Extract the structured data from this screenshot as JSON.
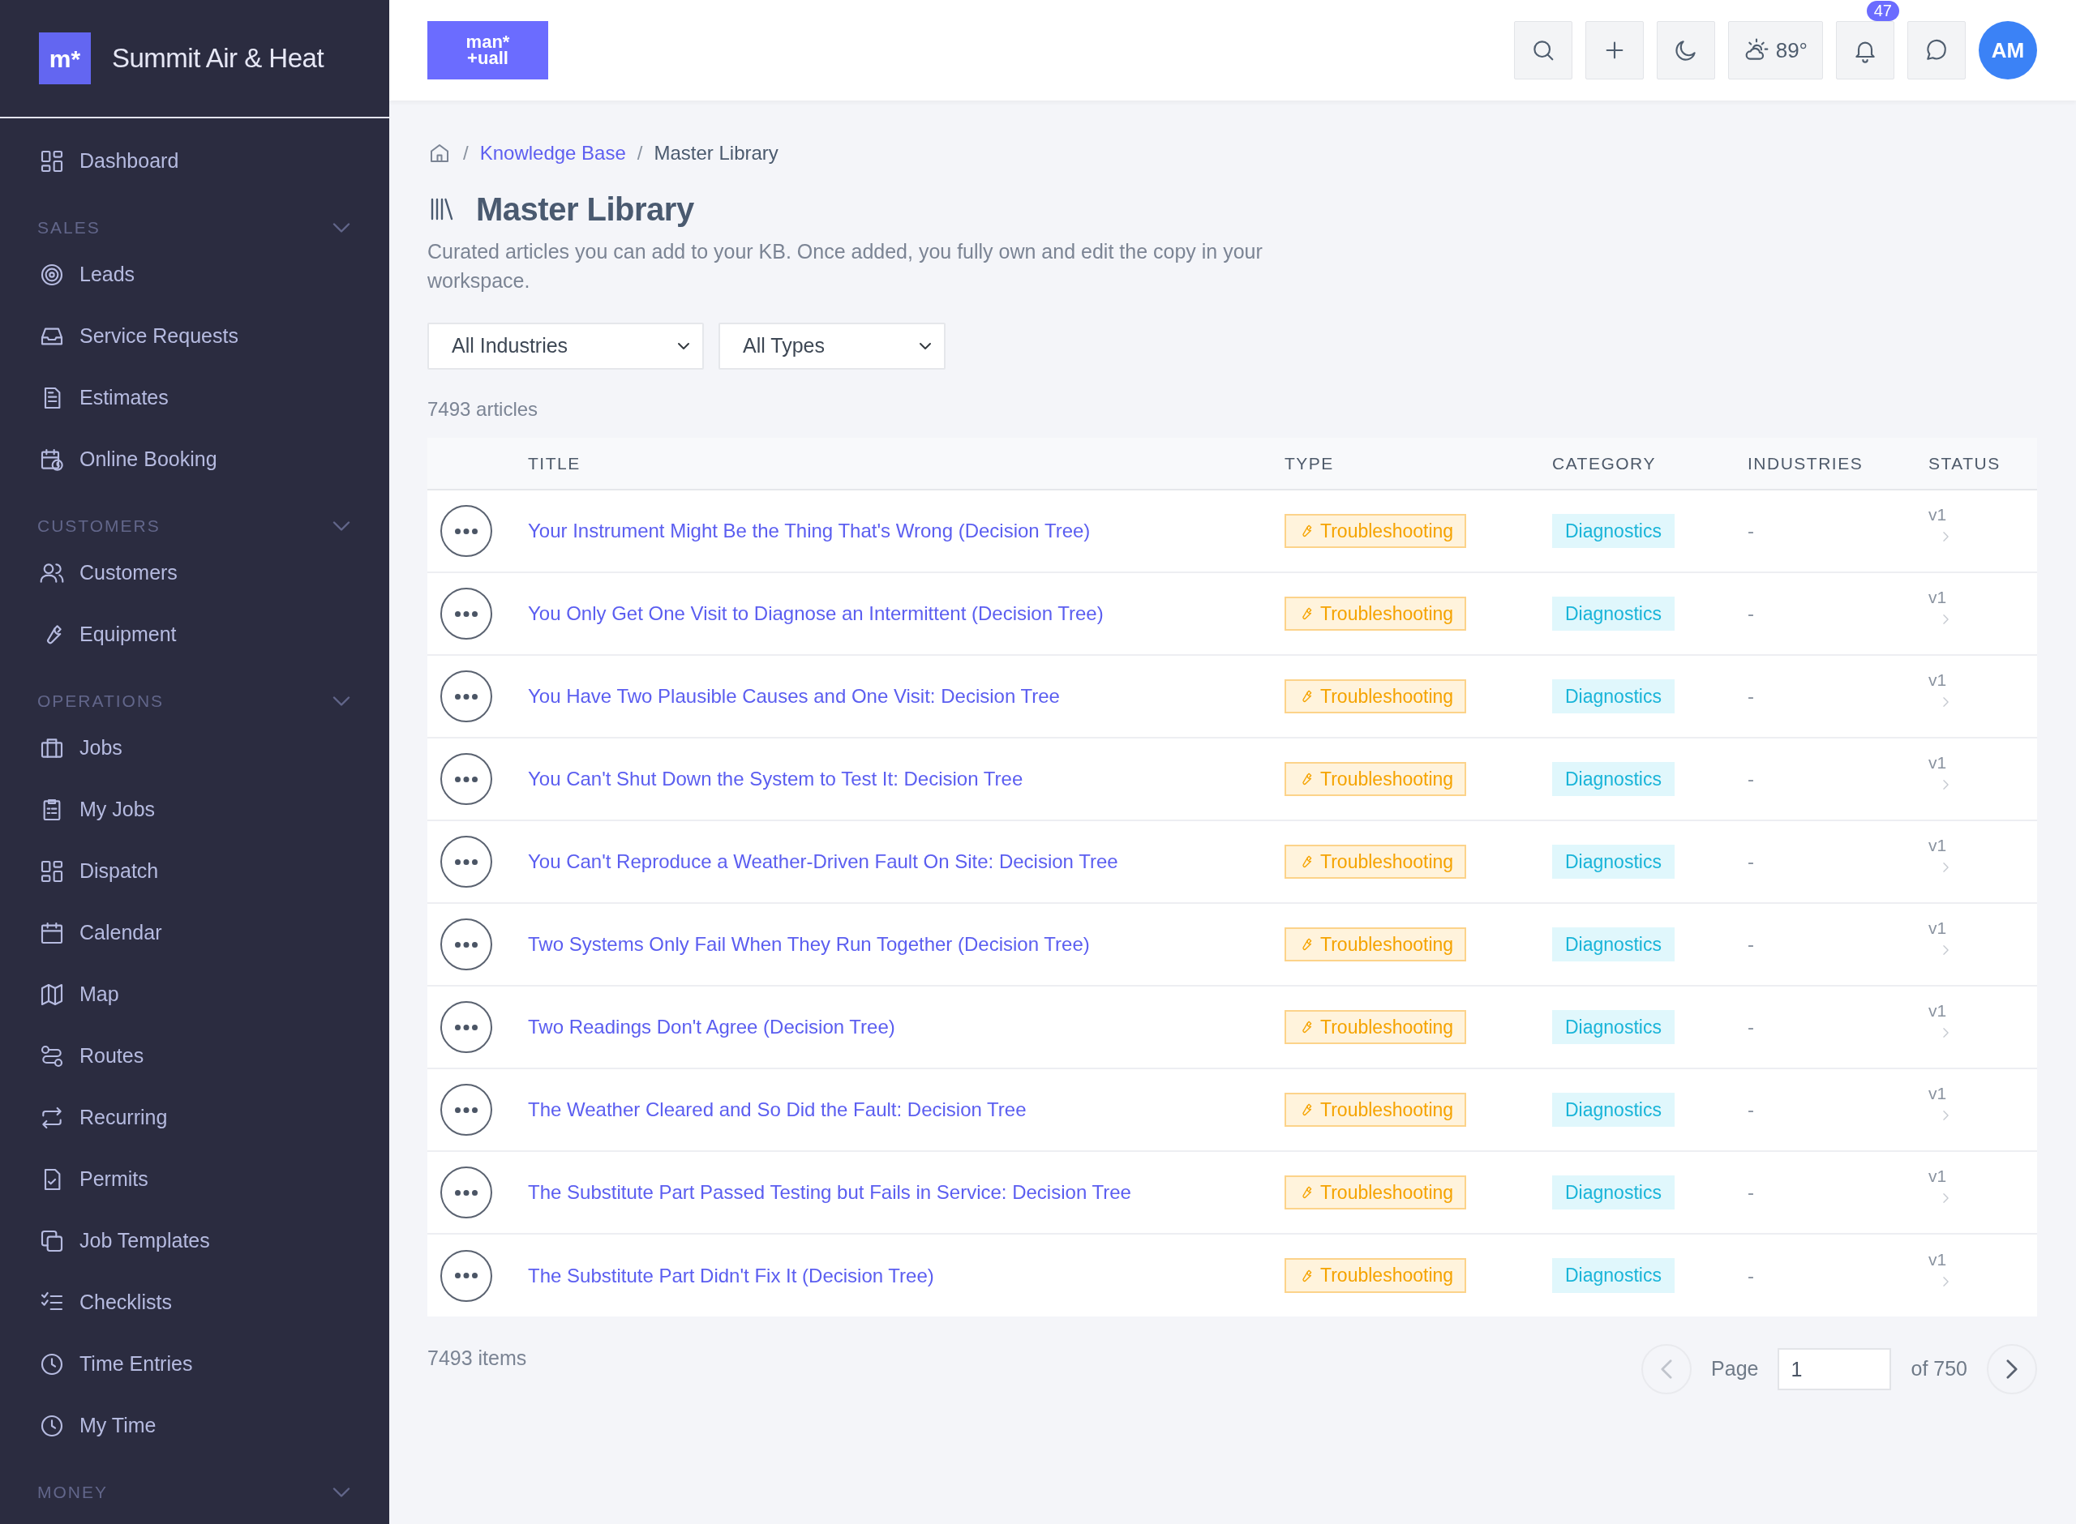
{
  "brand": {
    "logo": "m*",
    "name": "Summit Air & Heat"
  },
  "sidebar": {
    "top_items": [
      {
        "label": "Dashboard"
      }
    ],
    "sections": [
      {
        "title": "SALES",
        "items": [
          {
            "label": "Leads"
          },
          {
            "label": "Service Requests"
          },
          {
            "label": "Estimates"
          },
          {
            "label": "Online Booking"
          }
        ]
      },
      {
        "title": "CUSTOMERS",
        "items": [
          {
            "label": "Customers"
          },
          {
            "label": "Equipment"
          }
        ]
      },
      {
        "title": "OPERATIONS",
        "items": [
          {
            "label": "Jobs"
          },
          {
            "label": "My Jobs"
          },
          {
            "label": "Dispatch"
          },
          {
            "label": "Calendar"
          },
          {
            "label": "Map"
          },
          {
            "label": "Routes"
          },
          {
            "label": "Recurring"
          },
          {
            "label": "Permits"
          },
          {
            "label": "Job Templates"
          },
          {
            "label": "Checklists"
          },
          {
            "label": "Time Entries"
          },
          {
            "label": "My Time"
          }
        ]
      },
      {
        "title": "MONEY"
      }
    ]
  },
  "topbar": {
    "logo_lines": [
      "man*",
      "+uall"
    ],
    "weather": "89°",
    "notifications": "47",
    "avatar": "AM"
  },
  "breadcrumb": {
    "separator": "/",
    "items": [
      {
        "label": "Knowledge Base",
        "link": true
      },
      {
        "label": "Master Library",
        "link": false
      }
    ]
  },
  "page": {
    "title": "Master Library",
    "description": "Curated articles you can add to your KB. Once added, you fully own and edit the copy in your workspace."
  },
  "filters": [
    {
      "value": "All Industries"
    },
    {
      "value": "All Types"
    }
  ],
  "count": "7493 articles",
  "table": {
    "columns": [
      "TITLE",
      "TYPE",
      "CATEGORY",
      "INDUSTRIES",
      "STATUS"
    ],
    "rows": [
      {
        "title": "Your Instrument Might Be the Thing That's Wrong (Decision Tree)",
        "type": "Troubleshooting",
        "category": "Diagnostics",
        "industries": "-",
        "status": "v1"
      },
      {
        "title": "You Only Get One Visit to Diagnose an Intermittent (Decision Tree)",
        "type": "Troubleshooting",
        "category": "Diagnostics",
        "industries": "-",
        "status": "v1"
      },
      {
        "title": "You Have Two Plausible Causes and One Visit: Decision Tree",
        "type": "Troubleshooting",
        "category": "Diagnostics",
        "industries": "-",
        "status": "v1"
      },
      {
        "title": "You Can't Shut Down the System to Test It: Decision Tree",
        "type": "Troubleshooting",
        "category": "Diagnostics",
        "industries": "-",
        "status": "v1"
      },
      {
        "title": "You Can't Reproduce a Weather-Driven Fault On Site: Decision Tree",
        "type": "Troubleshooting",
        "category": "Diagnostics",
        "industries": "-",
        "status": "v1"
      },
      {
        "title": "Two Systems Only Fail When They Run Together (Decision Tree)",
        "type": "Troubleshooting",
        "category": "Diagnostics",
        "industries": "-",
        "status": "v1"
      },
      {
        "title": "Two Readings Don't Agree (Decision Tree)",
        "type": "Troubleshooting",
        "category": "Diagnostics",
        "industries": "-",
        "status": "v1"
      },
      {
        "title": "The Weather Cleared and So Did the Fault: Decision Tree",
        "type": "Troubleshooting",
        "category": "Diagnostics",
        "industries": "-",
        "status": "v1"
      },
      {
        "title": "The Substitute Part Passed Testing but Fails in Service: Decision Tree",
        "type": "Troubleshooting",
        "category": "Diagnostics",
        "industries": "-",
        "status": "v1"
      },
      {
        "title": "The Substitute Part Didn't Fix It (Decision Tree)",
        "type": "Troubleshooting",
        "category": "Diagnostics",
        "industries": "-",
        "status": "v1"
      }
    ]
  },
  "footer": {
    "items": "7493 items",
    "page_label": "Page",
    "page_value": "1",
    "of_label": "of 750",
    "prev_disabled": true,
    "next_disabled": false
  }
}
